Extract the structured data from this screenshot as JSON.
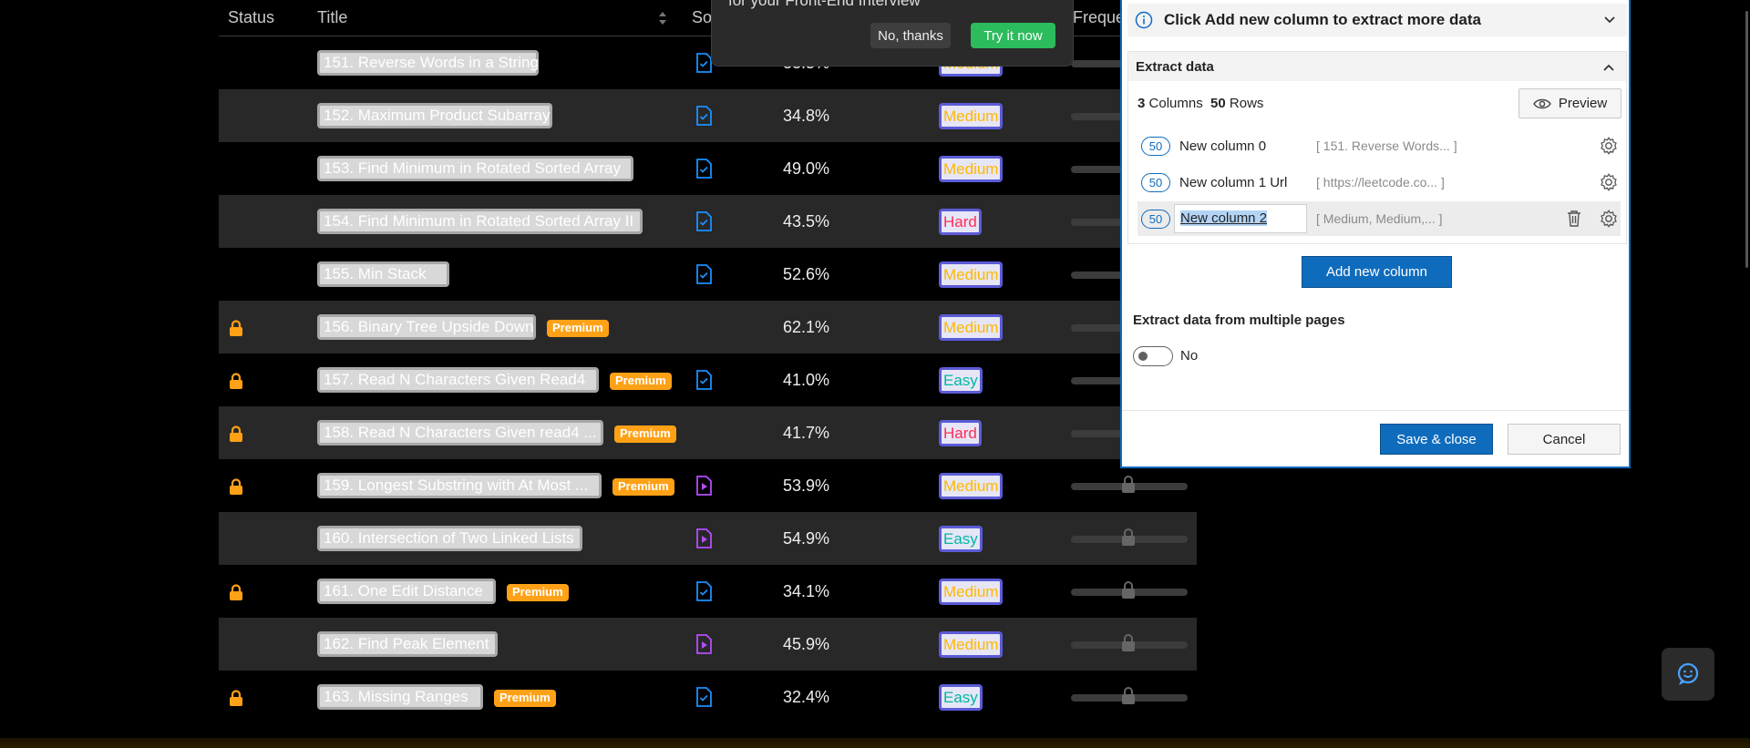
{
  "table": {
    "headers": {
      "status": "Status",
      "title": "Title",
      "solution": "So",
      "frequency": "Freque"
    },
    "rows": [
      {
        "title": "151. Reverse Words in a String",
        "acceptance": "33.5%",
        "difficulty": "Medium",
        "locked": false,
        "premium": false,
        "solution": "doc"
      },
      {
        "title": "152. Maximum Product Subarray",
        "acceptance": "34.8%",
        "difficulty": "Medium",
        "locked": false,
        "premium": false,
        "solution": "doc"
      },
      {
        "title": "153. Find Minimum in Rotated Sorted Array",
        "acceptance": "49.0%",
        "difficulty": "Medium",
        "locked": false,
        "premium": false,
        "solution": "doc"
      },
      {
        "title": "154. Find Minimum in Rotated Sorted Array II",
        "acceptance": "43.5%",
        "difficulty": "Hard",
        "locked": false,
        "premium": false,
        "solution": "doc"
      },
      {
        "title": "155. Min Stack",
        "acceptance": "52.6%",
        "difficulty": "Medium",
        "locked": false,
        "premium": false,
        "solution": "doc"
      },
      {
        "title": "156. Binary Tree Upside Down",
        "acceptance": "62.1%",
        "difficulty": "Medium",
        "locked": true,
        "premium": true,
        "solution": "none"
      },
      {
        "title": "157. Read N Characters Given Read4",
        "acceptance": "41.0%",
        "difficulty": "Easy",
        "locked": true,
        "premium": true,
        "solution": "doc"
      },
      {
        "title": "158. Read N Characters Given read4 ...",
        "acceptance": "41.7%",
        "difficulty": "Hard",
        "locked": true,
        "premium": true,
        "solution": "none"
      },
      {
        "title": "159. Longest Substring with At Most ...",
        "acceptance": "53.9%",
        "difficulty": "Medium",
        "locked": true,
        "premium": true,
        "solution": "video"
      },
      {
        "title": "160. Intersection of Two Linked Lists",
        "acceptance": "54.9%",
        "difficulty": "Easy",
        "locked": false,
        "premium": false,
        "solution": "video"
      },
      {
        "title": "161. One Edit Distance",
        "acceptance": "34.1%",
        "difficulty": "Medium",
        "locked": true,
        "premium": true,
        "solution": "doc"
      },
      {
        "title": "162. Find Peak Element",
        "acceptance": "45.9%",
        "difficulty": "Medium",
        "locked": false,
        "premium": false,
        "solution": "video"
      },
      {
        "title": "163. Missing Ranges",
        "acceptance": "32.4%",
        "difficulty": "Easy",
        "locked": true,
        "premium": true,
        "solution": "doc"
      }
    ],
    "premium_label": "Premium"
  },
  "toast": {
    "text": "for your Front-End Interview",
    "no_label": "No, thanks",
    "try_label": "Try it now"
  },
  "panel": {
    "tip": "Click Add new column to extract more data",
    "section_title": "Extract data",
    "columns_count": "3",
    "columns_label": "Columns",
    "rows_count": "50",
    "rows_label": "Rows",
    "preview_label": "Preview",
    "columns": [
      {
        "count": "50",
        "name": "New column 0",
        "sample": "[ 151. Reverse Words...  ]"
      },
      {
        "count": "50",
        "name": "New column 1 Url",
        "sample": "[ https://leetcode.co...  ]"
      },
      {
        "count": "50",
        "name": "New column 2",
        "sample": "[ Medium, Medium,...  ]"
      }
    ],
    "add_column_label": "Add new column",
    "multi_pages_label": "Extract data from multiple pages",
    "toggle_value": "No",
    "save_label": "Save & close",
    "cancel_label": "Cancel"
  },
  "colors": {
    "accent": "#0f6cbd",
    "premium": "#ffa116",
    "easy": "#00b8a3",
    "medium": "#ffb800",
    "hard": "#ff2d55",
    "try_button": "#2cbb5d"
  }
}
